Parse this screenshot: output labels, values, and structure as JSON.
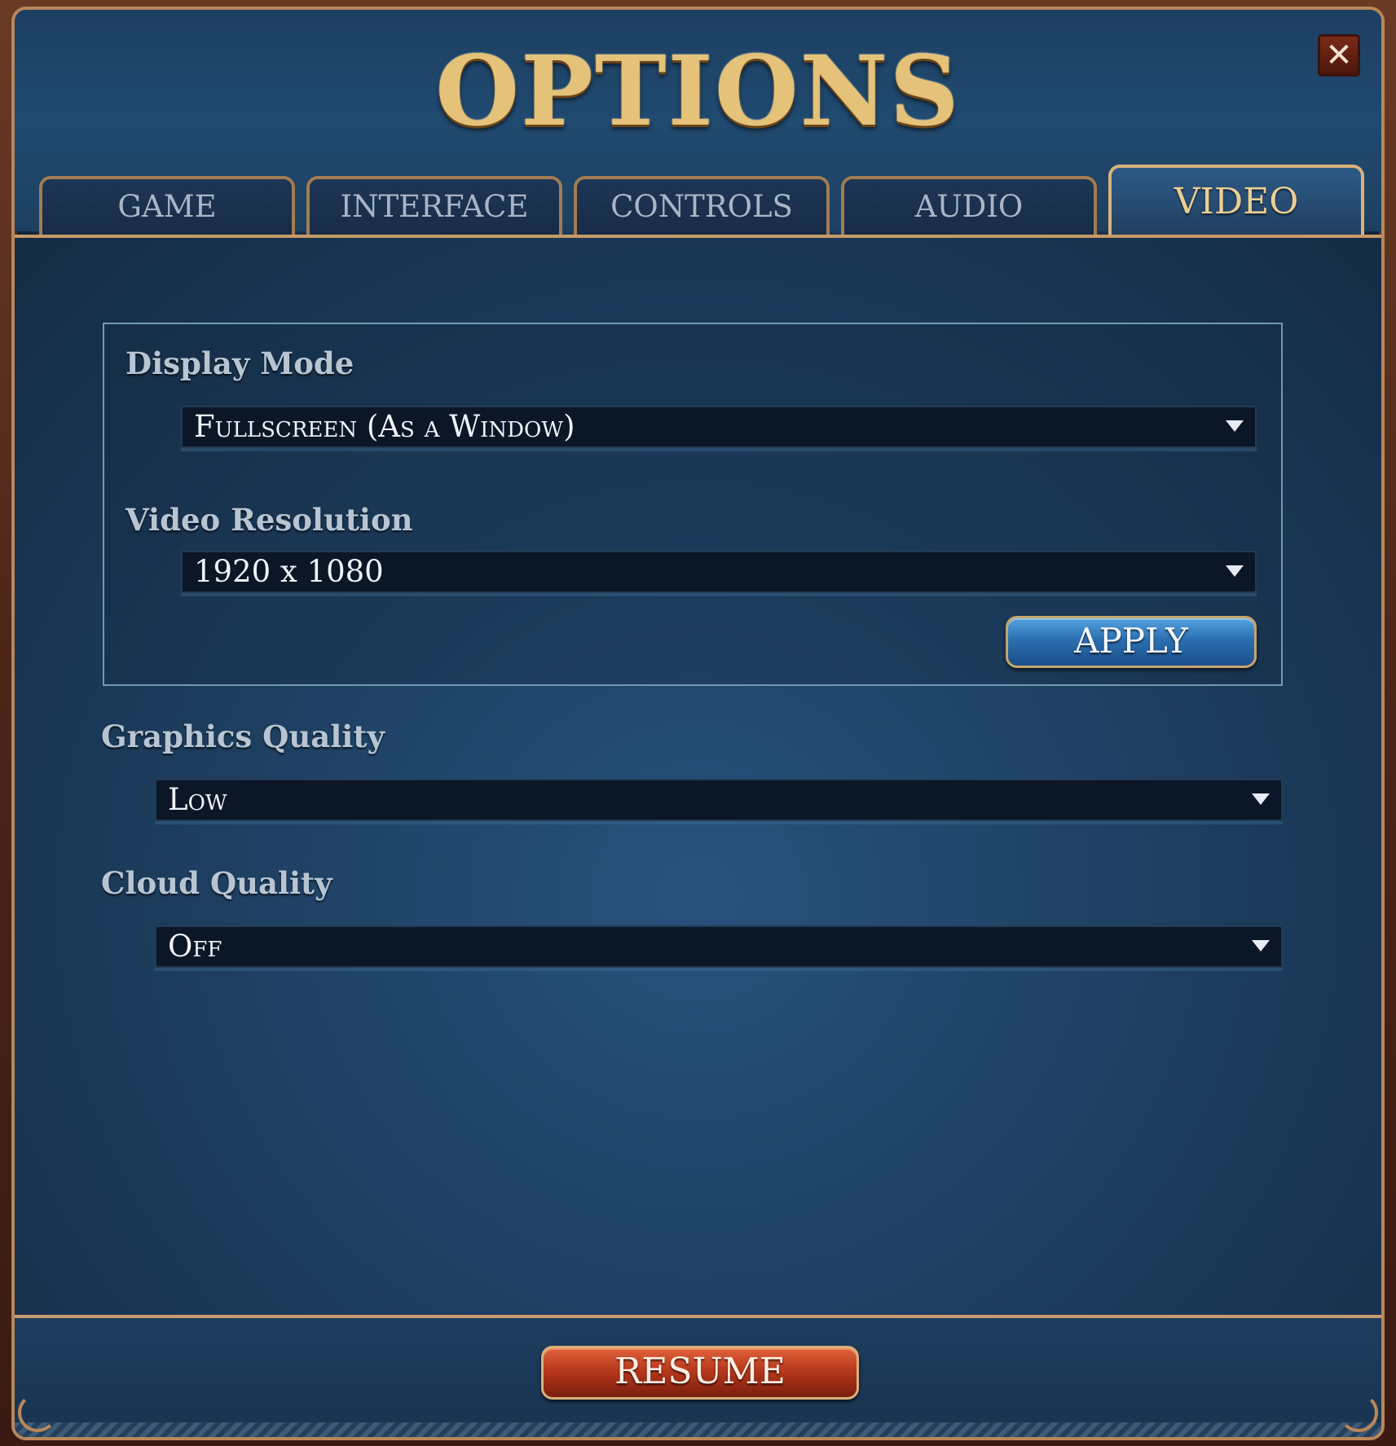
{
  "window": {
    "title": "OPTIONS",
    "close_label": "✕"
  },
  "tabs": [
    {
      "label": "GAME",
      "active": false
    },
    {
      "label": "INTERFACE",
      "active": false
    },
    {
      "label": "CONTROLS",
      "active": false
    },
    {
      "label": "AUDIO",
      "active": false
    },
    {
      "label": "VIDEO",
      "active": true
    }
  ],
  "video": {
    "display_mode": {
      "label": "Display Mode",
      "value": "Fullscreen (As a Window)"
    },
    "resolution": {
      "label": "Video Resolution",
      "value": "1920 x 1080"
    },
    "apply_label": "APPLY",
    "graphics_quality": {
      "label": "Graphics Quality",
      "value": "Low"
    },
    "cloud_quality": {
      "label": "Cloud Quality",
      "value": "Off"
    }
  },
  "footer": {
    "resume_label": "RESUME"
  },
  "colors": {
    "gold_title": "#e4c27a",
    "active_tab_text": "#ebcf92",
    "apply_blue": "#2b6fb2",
    "resume_red": "#b8381c"
  },
  "icons": {
    "close": "close-icon",
    "dropdown": "chevron-down-icon"
  }
}
